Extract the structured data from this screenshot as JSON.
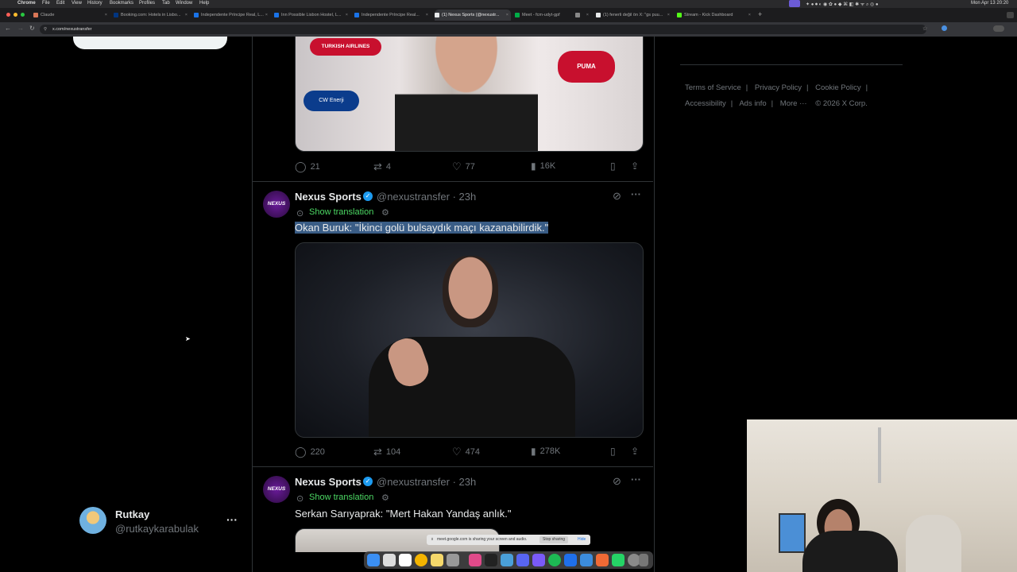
{
  "menubar": {
    "app": "Chrome",
    "items": [
      "File",
      "Edit",
      "View",
      "History",
      "Bookmarks",
      "Profiles",
      "Tab",
      "Window",
      "Help"
    ],
    "clock": "Mon Apr 13  20:20"
  },
  "tabs": [
    {
      "label": "Claude",
      "color": "#d97757"
    },
    {
      "label": "Booking.com: Hotels in Lisbo...",
      "color": "#003580"
    },
    {
      "label": "Independente Príncipe Real, L...",
      "color": "#1a73e8"
    },
    {
      "label": "Inn Possible Lisbon Hostel, L...",
      "color": "#1a73e8"
    },
    {
      "label": "Independente Príncipe Real...",
      "color": "#1a73e8"
    },
    {
      "label": "(1) Nexus Sports (@nexustr...",
      "color": "#e7e9ea"
    },
    {
      "label": "Meet - fcm-udyt-gpf",
      "color": "#00ac47"
    },
    {
      "label": "",
      "color": "#888888"
    },
    {
      "label": "(1) fenerli değil ön X: \"gs puu...",
      "color": "#e7e9ea"
    },
    {
      "label": "Stream - Kick Dashboard",
      "color": "#53fc18"
    }
  ],
  "address": {
    "url": "x.com/nexustransfer"
  },
  "tweet_top": {
    "sponsors": [
      "TURKISH AIRLINES",
      "CW Enerji",
      "PUMA"
    ],
    "replies": "21",
    "retweets": "4",
    "likes": "77",
    "views": "16K"
  },
  "tweet1": {
    "name": "Nexus Sports",
    "handle": "@nexustransfer · 23h",
    "avatar_text": "NEXUS",
    "translate": "Show translation",
    "text": "Okan Buruk: \"İkinci golü bulsaydık maçı kazanabilirdik.\"",
    "replies": "220",
    "retweets": "104",
    "likes": "474",
    "views": "278K"
  },
  "tweet2": {
    "name": "Nexus Sports",
    "handle": "@nexustransfer · 23h",
    "avatar_text": "NEXUS",
    "translate": "Show translation",
    "text": "Serkan Sarıyaprak: \"Mert Hakan Yandaş anlık.\""
  },
  "account": {
    "name": "Rutkay",
    "handle": "@rutkaykarabulak"
  },
  "footer": {
    "links": [
      "Terms of Service",
      "Privacy Policy",
      "Cookie Policy",
      "Accessibility",
      "Ads info",
      "More ···"
    ],
    "copyright": "© 2026 X Corp."
  },
  "share_bar": {
    "text": "meet.google.com is sharing your screen and audio.",
    "stop": "Stop sharing",
    "hide": "Hide"
  },
  "colors": {
    "accent": "#1d9bf0",
    "verified": "#1d9bf0",
    "bg": "#000000",
    "border": "#2f3336"
  }
}
